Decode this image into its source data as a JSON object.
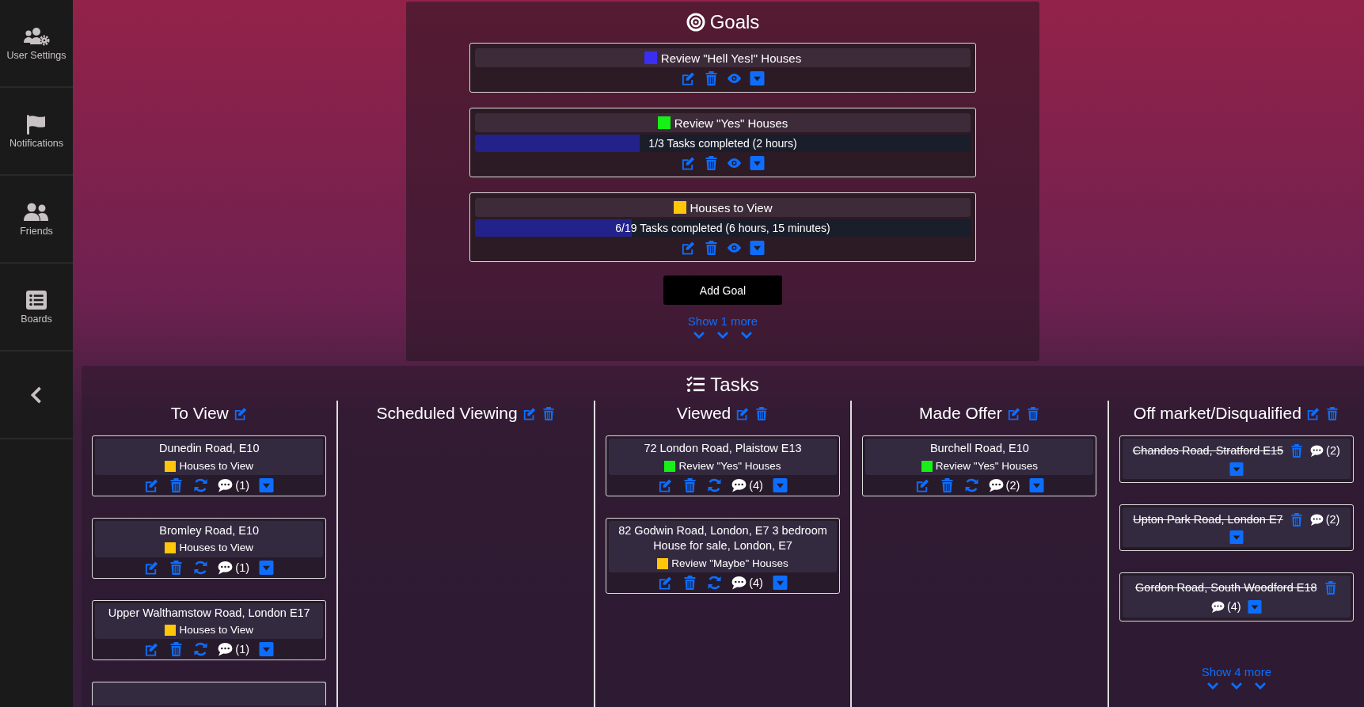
{
  "sidebar": {
    "items": [
      {
        "kind": "settings",
        "label": "User Settings"
      },
      {
        "kind": "notifications",
        "label": "Notifications"
      },
      {
        "kind": "friends",
        "label": "Friends"
      },
      {
        "kind": "boards",
        "label": "Boards"
      },
      {
        "kind": "collapse"
      }
    ]
  },
  "goals": {
    "title": "Goals",
    "items": [
      {
        "title": "Review \"Hell Yes!\" Houses",
        "color": "#3a2ff0"
      },
      {
        "title": "Review \"Yes\" Houses",
        "color": "#16f016",
        "progress": {
          "level": 0.333,
          "text": "1/3 Tasks completed (2 hours)"
        }
      },
      {
        "title": "Houses to View",
        "color": "#ffc60a",
        "progress": {
          "level": 0.316,
          "text": "6/19 Tasks completed (6 hours, 15 minutes)"
        }
      }
    ],
    "add_button": "Add Goal",
    "show_more": "Show 1 more"
  },
  "tasks": {
    "title": "Tasks",
    "columns": [
      {
        "title": "To View",
        "deletable": false,
        "cards": [
          {
            "title": "Dunedin Road, E10",
            "done": false,
            "goal": "Houses to View",
            "color": "#ffc60a",
            "comments": "(1)"
          },
          {
            "title": "Bromley Road, E10",
            "done": false,
            "goal": "Houses to View",
            "color": "#ffc60a",
            "comments": "(1)"
          },
          {
            "title": "Upper Walthamstow Road, London E17",
            "done": false,
            "goal": "Houses to View",
            "color": "#ffc60a",
            "comments": "(1)"
          }
        ],
        "more_cards_below": true
      },
      {
        "title": "Scheduled Viewing",
        "deletable": true
      },
      {
        "title": "Viewed",
        "deletable": true,
        "cards": [
          {
            "title": "72 London Road, Plaistow E13",
            "done": false,
            "goal": "Review \"Yes\" Houses",
            "color": "#16f016",
            "comments": "(4)"
          },
          {
            "title": "82 Godwin Road, London, E7 3 bedroom House for sale, London, E7",
            "done": false,
            "goal": "Review \"Maybe\" Houses",
            "color": "#ffc60a",
            "comments": "(4)"
          }
        ]
      },
      {
        "title": "Made Offer",
        "deletable": true,
        "cards": [
          {
            "title": "Burchell Road, E10",
            "done": false,
            "goal": "Review \"Yes\" Houses",
            "color": "#16f016",
            "comments": "(2)"
          }
        ]
      },
      {
        "title": "Off market/Disqualified",
        "deletable": true,
        "cards": [
          {
            "title": "Chandos Road, Stratford E15",
            "done": true,
            "comments": "(2)"
          },
          {
            "title": "Upton Park Road, London E7",
            "done": true,
            "comments": "(2)"
          },
          {
            "title": "Gordon Road, South Woodford E18",
            "done": true,
            "comments": "(4)"
          }
        ],
        "show_more": "Show 4 more"
      }
    ]
  }
}
